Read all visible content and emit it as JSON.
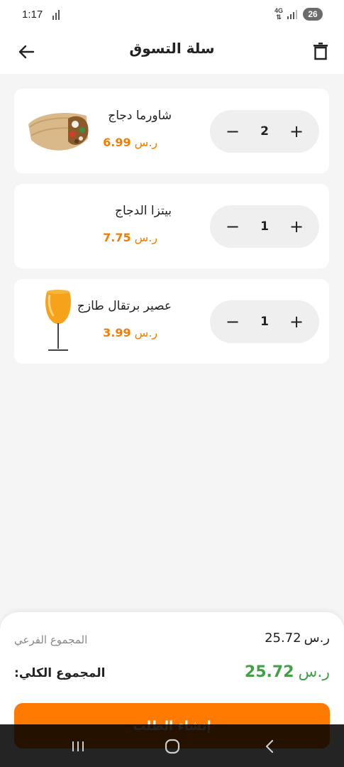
{
  "status_bar": {
    "time": "1:17",
    "network_top": "4G",
    "battery": "26"
  },
  "header": {
    "title": "سلة التسوق"
  },
  "items": [
    {
      "name": "شاورما دجاج",
      "price": "6.99",
      "currency": "ر.س",
      "quantity": "2",
      "image": "shawarma-wrap"
    },
    {
      "name": "بيتزا الدجاج",
      "price": "7.75",
      "currency": "ر.س",
      "quantity": "1",
      "image": ""
    },
    {
      "name": "عصير برتقال طازج",
      "price": "3.99",
      "currency": "ر.س",
      "quantity": "1",
      "image": "orange-juice-glass"
    }
  ],
  "summary": {
    "subtotal_label": "المجموع الفرعي",
    "subtotal_value": "25.72",
    "total_label": ":المجموع الكلي",
    "total_value": "25.72",
    "currency": "ر.س",
    "order_button": "إنشاء الطلب"
  },
  "colors": {
    "accent": "#ff7a00",
    "price": "#f57c00",
    "total": "#43a047"
  }
}
